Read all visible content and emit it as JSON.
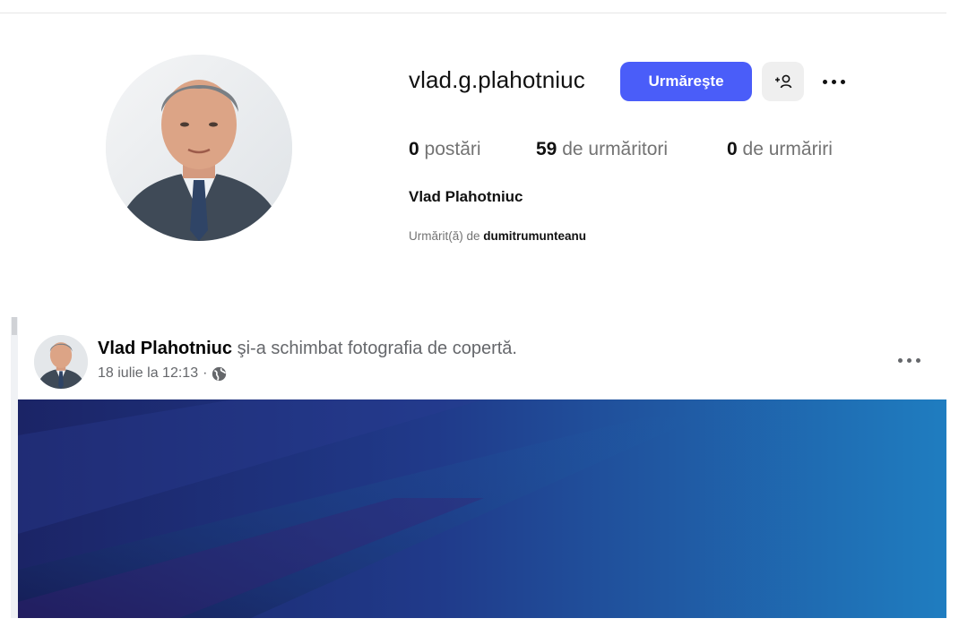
{
  "profile": {
    "username": "vlad.g.plahotniuc",
    "follow_label": "Urmăreşte",
    "stats": {
      "posts_count": "0",
      "posts_label": "postări",
      "followers_count": "59",
      "followers_label": "de urmăritori",
      "following_count": "0",
      "following_label": "de urmăriri"
    },
    "full_name": "Vlad Plahotniuc",
    "followed_by_prefix": "Urmărit(ă) de",
    "followed_by_user": "dumitrumunteanu"
  },
  "post": {
    "author": "Vlad Plahotniuc",
    "action": "şi-a schimbat fotografia de copertă.",
    "date": "18 iulie la 12:13",
    "separator": "·",
    "privacy_icon": "globe-icon",
    "menu_icon": "more-horizontal-icon"
  },
  "icons": {
    "add_user": "add-user-icon",
    "more": "more-horizontal-icon"
  },
  "colors": {
    "follow_button": "#4a5df9",
    "secondary_button": "#efefef",
    "cover_dark": "#1a2a6c",
    "cover_light": "#1f7dc0"
  }
}
